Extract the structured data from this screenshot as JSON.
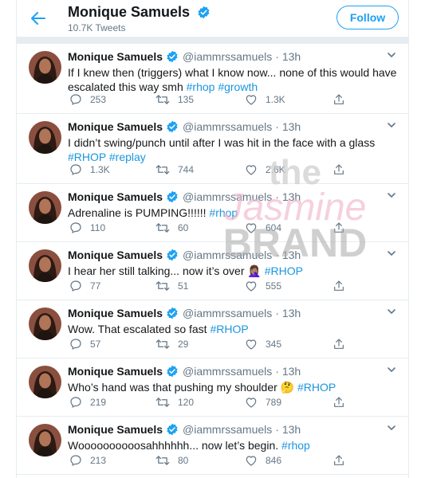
{
  "header": {
    "name": "Monique Samuels",
    "tweet_count": "10.7K Tweets",
    "follow_label": "Follow",
    "back_icon": "back-arrow-icon"
  },
  "colors": {
    "accent": "#1da1f2",
    "hashtag": "#1b95e0",
    "muted": "#657786",
    "divider": "#e6ecf0"
  },
  "watermark": {
    "line1": "the",
    "line2": "Jasmine",
    "line3": "BRAND"
  },
  "tweets": [
    {
      "name": "Monique Samuels",
      "handle": "@iammrssamuels",
      "time": "· 13h",
      "text": "If I knew then (triggers) what I know now... none of this would have escalated this way smh ",
      "tags": "#rhop #growth",
      "replies": "253",
      "retweets": "135",
      "likes": "1.3K"
    },
    {
      "name": "Monique Samuels",
      "handle": "@iammrssamuels",
      "time": "· 13h",
      "text": "I didn’t swing/punch until after I was hit in the face with a glass ",
      "tags": "#RHOP #replay",
      "replies": "1.3K",
      "retweets": "744",
      "likes": "2.6K"
    },
    {
      "name": "Monique Samuels",
      "handle": "@iammrssamuels",
      "time": "· 13h",
      "text": "Adrenaline is PUMPING!!!!!! ",
      "tags": "#rhop",
      "replies": "110",
      "retweets": "60",
      "likes": "604"
    },
    {
      "name": "Monique Samuels",
      "handle": "@iammrssamuels",
      "time": "· 13h",
      "text": "I hear her still talking... now it’s over 🤦🏽‍♀️ ",
      "tags": "#RHOP",
      "replies": "77",
      "retweets": "51",
      "likes": "555"
    },
    {
      "name": "Monique Samuels",
      "handle": "@iammrssamuels",
      "time": "· 13h",
      "text": "Wow. That escalated so fast ",
      "tags": "#RHOP",
      "replies": "57",
      "retweets": "29",
      "likes": "345"
    },
    {
      "name": "Monique Samuels",
      "handle": "@iammrssamuels",
      "time": "· 13h",
      "text": "Who’s hand was that pushing my shoulder 🤔 ",
      "tags": "#RHOP",
      "replies": "219",
      "retweets": "120",
      "likes": "789"
    },
    {
      "name": "Monique Samuels",
      "handle": "@iammrssamuels",
      "time": "· 13h",
      "text": "Woooooooooosahhhhhh... now let’s begin. ",
      "tags": "#rhop",
      "replies": "213",
      "retweets": "80",
      "likes": "846"
    }
  ]
}
